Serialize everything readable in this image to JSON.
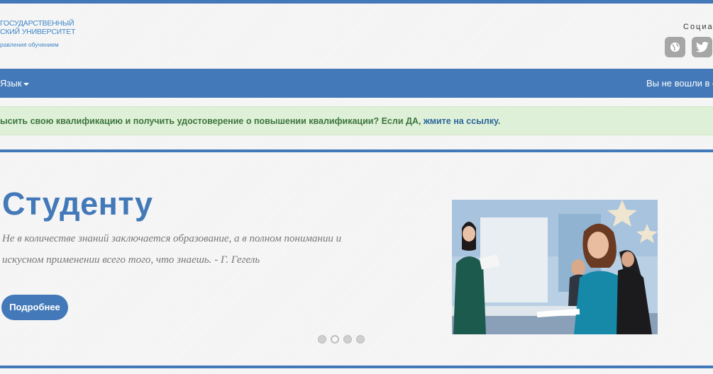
{
  "header": {
    "logo_line1": "ГОСУДАРСТВЕННЫЙ",
    "logo_line2": "СКИЙ УНИВЕРСИТЕТ",
    "logo_subtitle": "равления обучением",
    "social_label": "Социал",
    "social_icons": [
      "globe-icon",
      "twitter-icon"
    ]
  },
  "nav": {
    "language_label": "Язык",
    "login_status": "Вы не вошли в си"
  },
  "alert": {
    "text": "ысить свою квалификацию и получить удостоверение о повышении квалификации? Если ДА, ",
    "link_text": "жмите на ссылку",
    "suffix": "."
  },
  "slide": {
    "title": "Студенту",
    "quote": "Не в количестве знаний заключается образование, а в полном понимании и искусном применении всего того, что знаешь. - Г. Гегель",
    "button_label": "Подробнее",
    "dots_count": 4,
    "active_dot": 2
  },
  "colors": {
    "brand": "#4379b8",
    "alert_bg": "#dff0d8",
    "alert_text": "#3c763d",
    "social_bg": "#a6a6a6"
  }
}
